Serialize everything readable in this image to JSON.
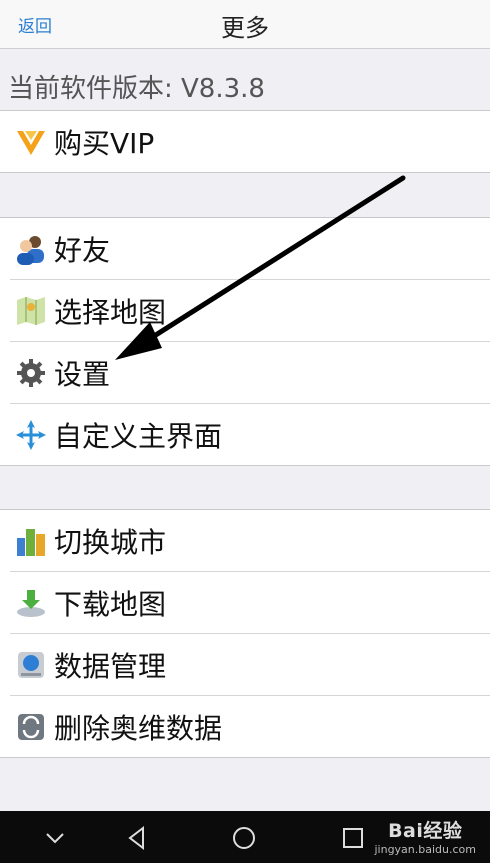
{
  "nav": {
    "back_label": "返回",
    "title": "更多"
  },
  "version_text": "当前软件版本: V8.3.8",
  "groups": [
    {
      "items": [
        {
          "label": "购买VIP",
          "icon": "vip-icon"
        }
      ]
    },
    {
      "items": [
        {
          "label": "好友",
          "icon": "friends-icon"
        },
        {
          "label": "选择地图",
          "icon": "map-select-icon"
        },
        {
          "label": "设置",
          "icon": "gear-icon"
        },
        {
          "label": "自定义主界面",
          "icon": "customize-icon"
        }
      ]
    },
    {
      "items": [
        {
          "label": "切换城市",
          "icon": "city-icon"
        },
        {
          "label": "下载地图",
          "icon": "download-icon"
        },
        {
          "label": "数据管理",
          "icon": "database-icon"
        },
        {
          "label": "删除奥维数据",
          "icon": "delete-data-icon"
        }
      ]
    }
  ],
  "system_nav": {
    "buttons": [
      "back-chevron-icon",
      "back-triangle-icon",
      "home-circle-icon",
      "recents-square-icon"
    ]
  },
  "watermark": {
    "logo": "Bai经验",
    "url": "jingyan.baidu.com"
  },
  "colors": {
    "accent": "#2a7fd4",
    "background": "#efeff4",
    "annotation_arrow": "#000000"
  }
}
